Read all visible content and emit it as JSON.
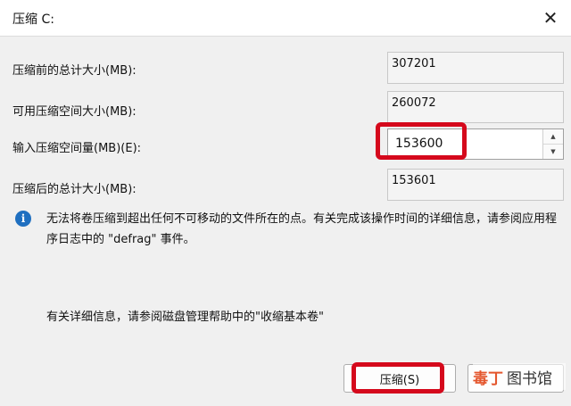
{
  "window": {
    "title": "压缩 C:",
    "close_glyph": "✕"
  },
  "fields": {
    "total_before": {
      "label": "压缩前的总计大小(MB):",
      "value": "307201"
    },
    "available": {
      "label": "可用压缩空间大小(MB):",
      "value": "260072"
    },
    "shrink_amount": {
      "label": "输入压缩空间量(MB)(E):",
      "value": "153600"
    },
    "total_after": {
      "label": "压缩后的总计大小(MB):",
      "value": "153601"
    }
  },
  "info": {
    "text": "无法将卷压缩到超出任何不可移动的文件所在的点。有关完成该操作时间的详细信息，请参阅应用程序日志中的 \"defrag\" 事件。",
    "help": "有关详细信息，请参阅磁盘管理帮助中的\"收缩基本卷\""
  },
  "buttons": {
    "shrink": "压缩(S)"
  },
  "watermark": {
    "logo": "毒丁",
    "text": "图书馆"
  },
  "colors": {
    "highlight": "#d5091c",
    "info_icon": "#1f6fc0"
  },
  "icons": {
    "info": "info-icon",
    "close": "close-icon",
    "spin_up": "chevron-up-icon",
    "spin_down": "chevron-down-icon"
  }
}
